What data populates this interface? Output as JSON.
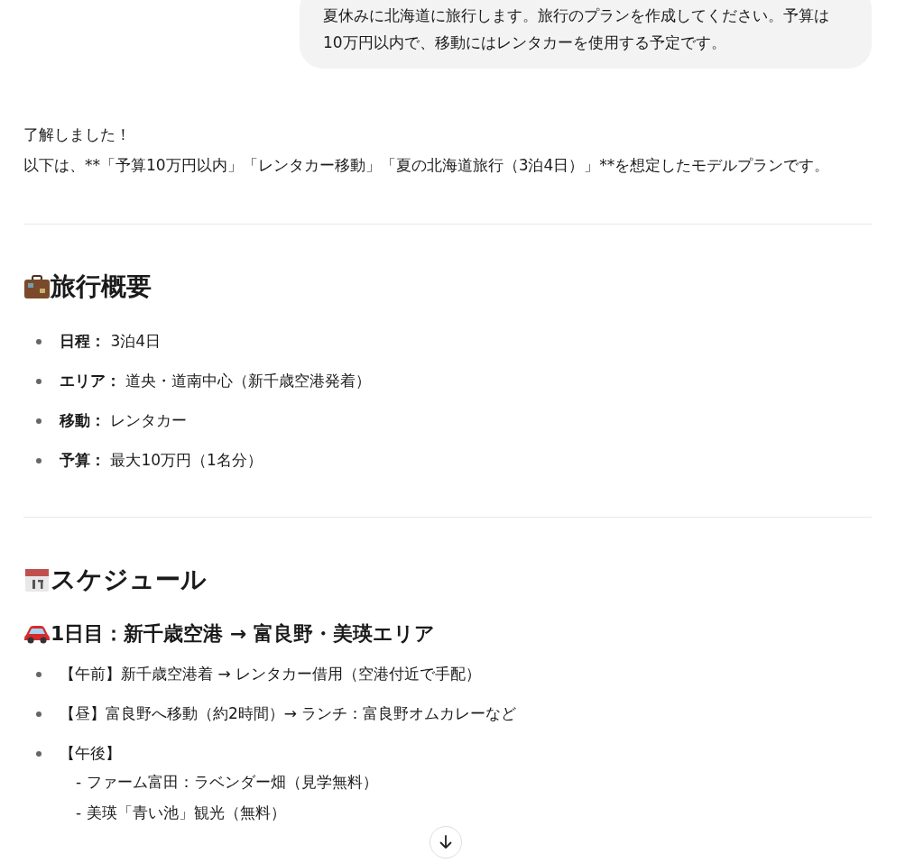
{
  "user_message": "夏休みに北海道に旅行します。旅行のプランを作成してください。予算は10万円以内で、移動にはレンタカーを使用する予定です。",
  "reply_intro": [
    "了解しました！",
    "以下は、**「予算10万円以内」「レンタカー移動」「夏の北海道旅行（3泊4日）」**を想定したモデルプランです。"
  ],
  "overview": {
    "heading": "旅行概要",
    "items": [
      {
        "label": "日程：",
        "value": "3泊4日"
      },
      {
        "label": "エリア：",
        "value": "道央・道南中心（新千歳空港発着）"
      },
      {
        "label": "移動：",
        "value": "レンタカー"
      },
      {
        "label": "予算：",
        "value": "最大10万円（1名分）"
      }
    ]
  },
  "schedule": {
    "heading": "スケジュール",
    "day": {
      "title": "1日目：新千歳空港 → 富良野・美瑛エリア",
      "items": [
        {
          "text": "【午前】新千歳空港着 → レンタカー借用（空港付近で手配）"
        },
        {
          "text": "【昼】富良野へ移動（約2時間）→ ランチ：富良野オムカレーなど"
        },
        {
          "text": "【午後】",
          "lines": [
            "- ファーム富田：ラベンダー畑（見学無料）",
            "- 美瑛「青い池」観光（無料）"
          ]
        }
      ]
    }
  }
}
